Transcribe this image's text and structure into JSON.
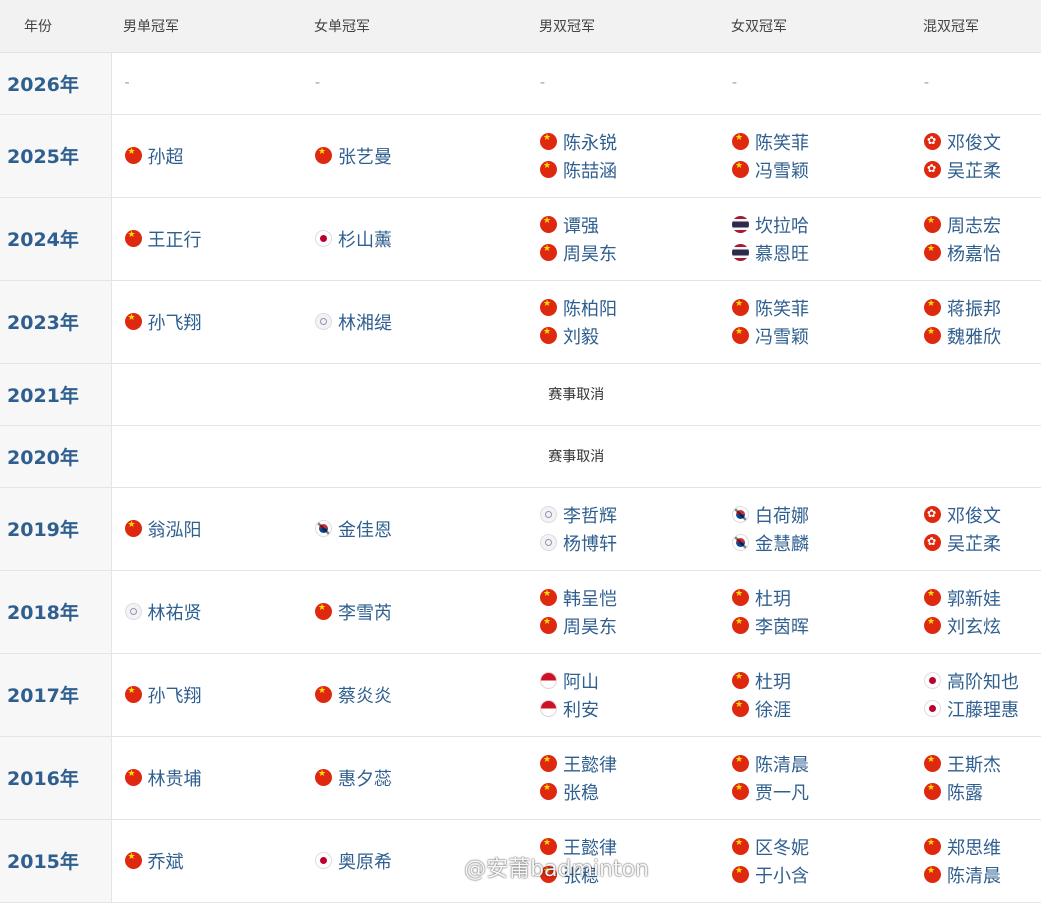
{
  "headers": {
    "year": "年份",
    "ms": "男单冠军",
    "ws": "女单冠军",
    "md": "男双冠军",
    "wd": "女双冠军",
    "xd": "混双冠军"
  },
  "cancelled_text": "赛事取消",
  "dash": "-",
  "watermark": "@安莆badminton",
  "rows": [
    {
      "year": "2026年",
      "dash": true
    },
    {
      "year": "2025年",
      "ms": [
        {
          "name": "孙超",
          "flag": "cn"
        }
      ],
      "ws": [
        {
          "name": "张艺曼",
          "flag": "cn"
        }
      ],
      "md": [
        {
          "name": "陈永锐",
          "flag": "cn"
        },
        {
          "name": "陈喆涵",
          "flag": "cn"
        }
      ],
      "wd": [
        {
          "name": "陈笑菲",
          "flag": "cn"
        },
        {
          "name": "冯雪颖",
          "flag": "cn"
        }
      ],
      "xd": [
        {
          "name": "邓俊文",
          "flag": "hk"
        },
        {
          "name": "吴芷柔",
          "flag": "hk"
        }
      ]
    },
    {
      "year": "2024年",
      "ms": [
        {
          "name": "王正行",
          "flag": "cn"
        }
      ],
      "ws": [
        {
          "name": "杉山薰",
          "flag": "jp"
        }
      ],
      "md": [
        {
          "name": "谭强",
          "flag": "cn"
        },
        {
          "name": "周昊东",
          "flag": "cn"
        }
      ],
      "wd": [
        {
          "name": "坎拉哈",
          "flag": "th"
        },
        {
          "name": "慕恩旺",
          "flag": "th"
        }
      ],
      "xd": [
        {
          "name": "周志宏",
          "flag": "cn"
        },
        {
          "name": "杨嘉怡",
          "flag": "cn"
        }
      ]
    },
    {
      "year": "2023年",
      "ms": [
        {
          "name": "孙飞翔",
          "flag": "cn"
        }
      ],
      "ws": [
        {
          "name": "林湘缇",
          "flag": "tpe"
        }
      ],
      "md": [
        {
          "name": "陈柏阳",
          "flag": "cn"
        },
        {
          "name": "刘毅",
          "flag": "cn"
        }
      ],
      "wd": [
        {
          "name": "陈笑菲",
          "flag": "cn"
        },
        {
          "name": "冯雪颖",
          "flag": "cn"
        }
      ],
      "xd": [
        {
          "name": "蒋振邦",
          "flag": "cn"
        },
        {
          "name": "魏雅欣",
          "flag": "cn"
        }
      ]
    },
    {
      "year": "2021年",
      "cancelled": true
    },
    {
      "year": "2020年",
      "cancelled": true
    },
    {
      "year": "2019年",
      "ms": [
        {
          "name": "翁泓阳",
          "flag": "cn"
        }
      ],
      "ws": [
        {
          "name": "金佳恩",
          "flag": "kr"
        }
      ],
      "md": [
        {
          "name": "李哲辉",
          "flag": "tpe"
        },
        {
          "name": "杨博轩",
          "flag": "tpe"
        }
      ],
      "wd": [
        {
          "name": "白荷娜",
          "flag": "kr"
        },
        {
          "name": "金慧麟",
          "flag": "kr"
        }
      ],
      "xd": [
        {
          "name": "邓俊文",
          "flag": "hk"
        },
        {
          "name": "吴芷柔",
          "flag": "hk"
        }
      ]
    },
    {
      "year": "2018年",
      "ms": [
        {
          "name": "林祐贤",
          "flag": "tpe"
        }
      ],
      "ws": [
        {
          "name": "李雪芮",
          "flag": "cn"
        }
      ],
      "md": [
        {
          "name": "韩呈恺",
          "flag": "cn"
        },
        {
          "name": "周昊东",
          "flag": "cn"
        }
      ],
      "wd": [
        {
          "name": "杜玥",
          "flag": "cn"
        },
        {
          "name": "李茵晖",
          "flag": "cn"
        }
      ],
      "xd": [
        {
          "name": "郭新娃",
          "flag": "cn"
        },
        {
          "name": "刘玄炫",
          "flag": "cn"
        }
      ]
    },
    {
      "year": "2017年",
      "ms": [
        {
          "name": "孙飞翔",
          "flag": "cn"
        }
      ],
      "ws": [
        {
          "name": "蔡炎炎",
          "flag": "cn"
        }
      ],
      "md": [
        {
          "name": "阿山",
          "flag": "id"
        },
        {
          "name": "利安",
          "flag": "id"
        }
      ],
      "wd": [
        {
          "name": "杜玥",
          "flag": "cn"
        },
        {
          "name": "徐涯",
          "flag": "cn"
        }
      ],
      "xd": [
        {
          "name": "高阶知也",
          "flag": "jp"
        },
        {
          "name": "江藤理惠",
          "flag": "jp"
        }
      ]
    },
    {
      "year": "2016年",
      "ms": [
        {
          "name": "林贵埔",
          "flag": "cn"
        }
      ],
      "ws": [
        {
          "name": "惠夕蕊",
          "flag": "cn"
        }
      ],
      "md": [
        {
          "name": "王懿律",
          "flag": "cn"
        },
        {
          "name": "张稳",
          "flag": "cn"
        }
      ],
      "wd": [
        {
          "name": "陈清晨",
          "flag": "cn"
        },
        {
          "name": "贾一凡",
          "flag": "cn"
        }
      ],
      "xd": [
        {
          "name": "王斯杰",
          "flag": "cn"
        },
        {
          "name": "陈露",
          "flag": "cn"
        }
      ]
    },
    {
      "year": "2015年",
      "ms": [
        {
          "name": "乔斌",
          "flag": "cn"
        }
      ],
      "ws": [
        {
          "name": "奥原希",
          "flag": "jp"
        }
      ],
      "md": [
        {
          "name": "王懿律",
          "flag": "cn"
        },
        {
          "name": "张稳",
          "flag": "cn"
        }
      ],
      "wd": [
        {
          "name": "区冬妮",
          "flag": "cn"
        },
        {
          "name": "于小含",
          "flag": "cn"
        }
      ],
      "xd": [
        {
          "name": "郑思维",
          "flag": "cn"
        },
        {
          "name": "陈清晨",
          "flag": "cn"
        }
      ]
    }
  ]
}
